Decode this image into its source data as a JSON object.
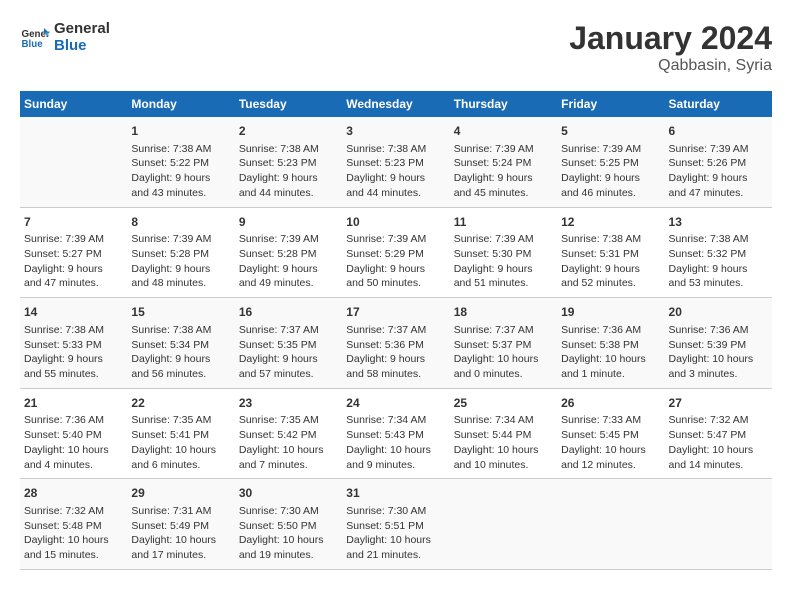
{
  "header": {
    "logo_line1": "General",
    "logo_line2": "Blue",
    "title": "January 2024",
    "subtitle": "Qabbasin, Syria"
  },
  "columns": [
    "Sunday",
    "Monday",
    "Tuesday",
    "Wednesday",
    "Thursday",
    "Friday",
    "Saturday"
  ],
  "rows": [
    [
      {
        "day": "",
        "info": ""
      },
      {
        "day": "1",
        "info": "Sunrise: 7:38 AM\nSunset: 5:22 PM\nDaylight: 9 hours\nand 43 minutes."
      },
      {
        "day": "2",
        "info": "Sunrise: 7:38 AM\nSunset: 5:23 PM\nDaylight: 9 hours\nand 44 minutes."
      },
      {
        "day": "3",
        "info": "Sunrise: 7:38 AM\nSunset: 5:23 PM\nDaylight: 9 hours\nand 44 minutes."
      },
      {
        "day": "4",
        "info": "Sunrise: 7:39 AM\nSunset: 5:24 PM\nDaylight: 9 hours\nand 45 minutes."
      },
      {
        "day": "5",
        "info": "Sunrise: 7:39 AM\nSunset: 5:25 PM\nDaylight: 9 hours\nand 46 minutes."
      },
      {
        "day": "6",
        "info": "Sunrise: 7:39 AM\nSunset: 5:26 PM\nDaylight: 9 hours\nand 47 minutes."
      }
    ],
    [
      {
        "day": "7",
        "info": "Sunrise: 7:39 AM\nSunset: 5:27 PM\nDaylight: 9 hours\nand 47 minutes."
      },
      {
        "day": "8",
        "info": "Sunrise: 7:39 AM\nSunset: 5:28 PM\nDaylight: 9 hours\nand 48 minutes."
      },
      {
        "day": "9",
        "info": "Sunrise: 7:39 AM\nSunset: 5:28 PM\nDaylight: 9 hours\nand 49 minutes."
      },
      {
        "day": "10",
        "info": "Sunrise: 7:39 AM\nSunset: 5:29 PM\nDaylight: 9 hours\nand 50 minutes."
      },
      {
        "day": "11",
        "info": "Sunrise: 7:39 AM\nSunset: 5:30 PM\nDaylight: 9 hours\nand 51 minutes."
      },
      {
        "day": "12",
        "info": "Sunrise: 7:38 AM\nSunset: 5:31 PM\nDaylight: 9 hours\nand 52 minutes."
      },
      {
        "day": "13",
        "info": "Sunrise: 7:38 AM\nSunset: 5:32 PM\nDaylight: 9 hours\nand 53 minutes."
      }
    ],
    [
      {
        "day": "14",
        "info": "Sunrise: 7:38 AM\nSunset: 5:33 PM\nDaylight: 9 hours\nand 55 minutes."
      },
      {
        "day": "15",
        "info": "Sunrise: 7:38 AM\nSunset: 5:34 PM\nDaylight: 9 hours\nand 56 minutes."
      },
      {
        "day": "16",
        "info": "Sunrise: 7:37 AM\nSunset: 5:35 PM\nDaylight: 9 hours\nand 57 minutes."
      },
      {
        "day": "17",
        "info": "Sunrise: 7:37 AM\nSunset: 5:36 PM\nDaylight: 9 hours\nand 58 minutes."
      },
      {
        "day": "18",
        "info": "Sunrise: 7:37 AM\nSunset: 5:37 PM\nDaylight: 10 hours\nand 0 minutes."
      },
      {
        "day": "19",
        "info": "Sunrise: 7:36 AM\nSunset: 5:38 PM\nDaylight: 10 hours\nand 1 minute."
      },
      {
        "day": "20",
        "info": "Sunrise: 7:36 AM\nSunset: 5:39 PM\nDaylight: 10 hours\nand 3 minutes."
      }
    ],
    [
      {
        "day": "21",
        "info": "Sunrise: 7:36 AM\nSunset: 5:40 PM\nDaylight: 10 hours\nand 4 minutes."
      },
      {
        "day": "22",
        "info": "Sunrise: 7:35 AM\nSunset: 5:41 PM\nDaylight: 10 hours\nand 6 minutes."
      },
      {
        "day": "23",
        "info": "Sunrise: 7:35 AM\nSunset: 5:42 PM\nDaylight: 10 hours\nand 7 minutes."
      },
      {
        "day": "24",
        "info": "Sunrise: 7:34 AM\nSunset: 5:43 PM\nDaylight: 10 hours\nand 9 minutes."
      },
      {
        "day": "25",
        "info": "Sunrise: 7:34 AM\nSunset: 5:44 PM\nDaylight: 10 hours\nand 10 minutes."
      },
      {
        "day": "26",
        "info": "Sunrise: 7:33 AM\nSunset: 5:45 PM\nDaylight: 10 hours\nand 12 minutes."
      },
      {
        "day": "27",
        "info": "Sunrise: 7:32 AM\nSunset: 5:47 PM\nDaylight: 10 hours\nand 14 minutes."
      }
    ],
    [
      {
        "day": "28",
        "info": "Sunrise: 7:32 AM\nSunset: 5:48 PM\nDaylight: 10 hours\nand 15 minutes."
      },
      {
        "day": "29",
        "info": "Sunrise: 7:31 AM\nSunset: 5:49 PM\nDaylight: 10 hours\nand 17 minutes."
      },
      {
        "day": "30",
        "info": "Sunrise: 7:30 AM\nSunset: 5:50 PM\nDaylight: 10 hours\nand 19 minutes."
      },
      {
        "day": "31",
        "info": "Sunrise: 7:30 AM\nSunset: 5:51 PM\nDaylight: 10 hours\nand 21 minutes."
      },
      {
        "day": "",
        "info": ""
      },
      {
        "day": "",
        "info": ""
      },
      {
        "day": "",
        "info": ""
      }
    ]
  ]
}
